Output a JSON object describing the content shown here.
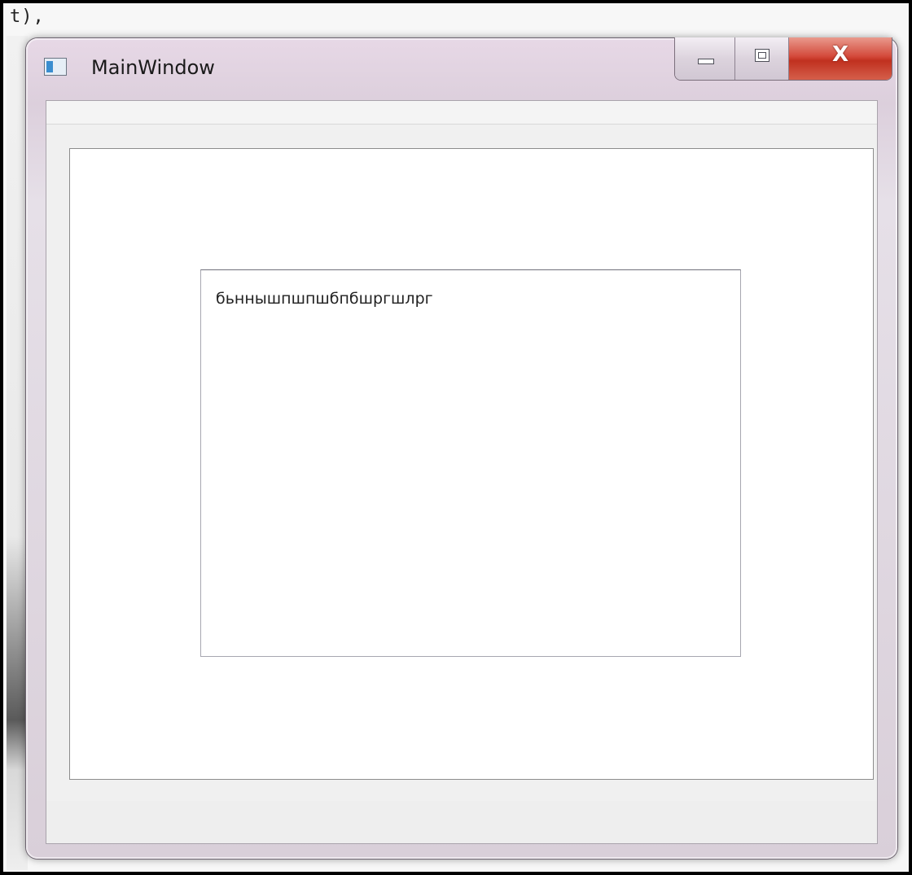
{
  "background": {
    "code_fragment": "t),"
  },
  "window": {
    "title": "MainWindow",
    "icon": "app-window-icon",
    "caption_buttons": {
      "minimize_icon": "minimize-icon",
      "maximize_icon": "maximize-icon",
      "close_icon": "close-icon",
      "close_glyph": "X"
    }
  },
  "text_edit": {
    "content": "бьннышпшпшбпбшргшлрг"
  },
  "colors": {
    "close_button": "#c9402f",
    "title_bar": "#e2d6e2",
    "client_bg": "#f0f0f0"
  }
}
